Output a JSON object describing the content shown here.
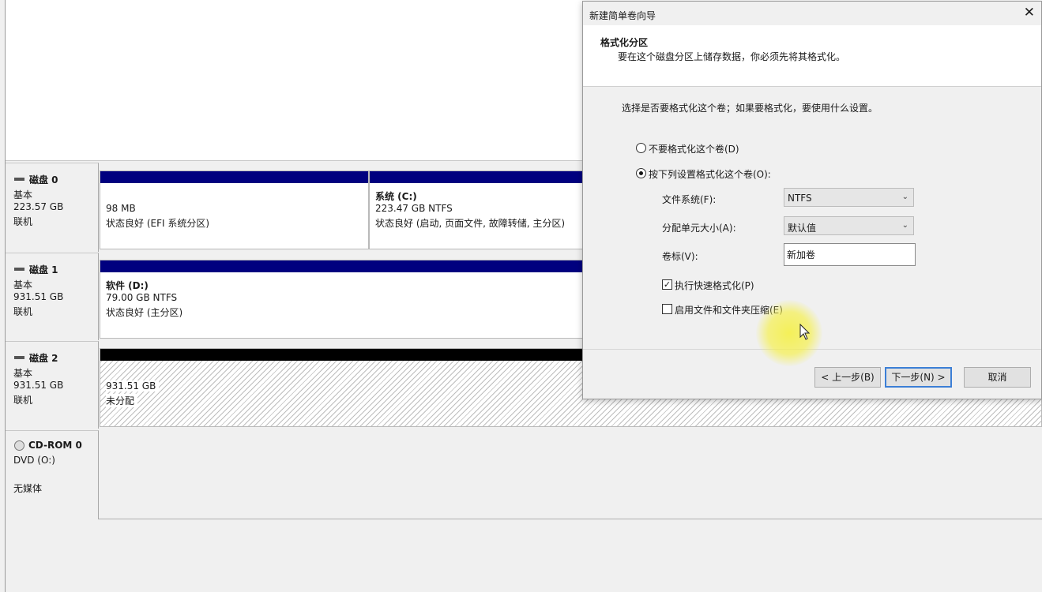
{
  "dialog": {
    "title": "新建简单卷向导",
    "close": "✕",
    "header_title": "格式化分区",
    "header_subtitle": "要在这个磁盘分区上储存数据，你必须先将其格式化。",
    "prompt": "选择是否要格式化这个卷；如果要格式化，要使用什么设置。",
    "option_no_format": "不要格式化这个卷(D)",
    "option_format": "按下列设置格式化这个卷(O):",
    "selected_option": "format",
    "filesystem_label": "文件系统(F):",
    "filesystem_value": "NTFS",
    "alloc_label": "分配单元大小(A):",
    "alloc_value": "默认值",
    "volume_label_label": "卷标(V):",
    "volume_label_value": "新加卷",
    "quick_format_label": "执行快速格式化(P)",
    "quick_format_checked": true,
    "compression_label": "启用文件和文件夹压缩(E)",
    "compression_checked": false,
    "back_button": "< 上一步(B)",
    "next_button": "下一步(N) >",
    "cancel_button": "取消"
  },
  "disks": [
    {
      "name": "磁盘 0",
      "type": "基本",
      "size": "223.57 GB",
      "status": "联机",
      "partitions": [
        {
          "title": "",
          "line1": "98 MB",
          "line2": "状态良好 (EFI 系统分区)"
        },
        {
          "title": "系统  (C:)",
          "line1": "223.47 GB NTFS",
          "line2": "状态良好 (启动, 页面文件, 故障转储, 主分区)"
        }
      ]
    },
    {
      "name": "磁盘 1",
      "type": "基本",
      "size": "931.51 GB",
      "status": "联机",
      "partitions": [
        {
          "title": "软件  (D:)",
          "line1": "79.00 GB NTFS",
          "line2": "状态良好 (主分区)"
        }
      ]
    },
    {
      "name": "磁盘 2",
      "type": "基本",
      "size": "931.51 GB",
      "status": "联机",
      "partitions": [
        {
          "title": "",
          "line1": "931.51 GB",
          "line2": "未分配"
        }
      ]
    }
  ],
  "cdrom": {
    "name": "CD-ROM 0",
    "drive": "DVD (O:)",
    "status": "无媒体"
  },
  "colors": {
    "primary_partition_bar": "#00007f",
    "unallocated_bar": "#000000",
    "focus_border": "#3c7fd6",
    "cursor_highlight": "#f5f050"
  }
}
